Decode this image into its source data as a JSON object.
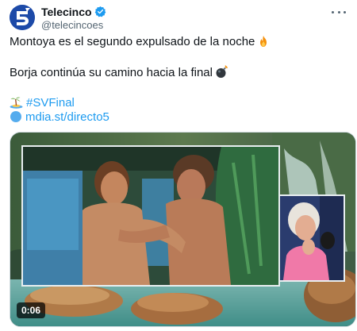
{
  "tweet": {
    "display_name": "Telecinco",
    "handle": "@telecincoes",
    "avatar_icon": "telecinco-5-logo",
    "verified_icon": "verified-badge-icon",
    "more_icon": "more-options-icon",
    "line1": "Montoya es el segundo expulsado de la noche",
    "line1_emoji": "fire-icon",
    "line2": "Borja continúa su camino hacia la final",
    "line2_emoji": "bomb-icon",
    "hashtag": "#SVFinal",
    "hashtag_icon": "desert-island-icon",
    "link": "mdia.st/directo5",
    "link_icon": "blue-circle-icon"
  },
  "media": {
    "type": "video",
    "duration": "0:06"
  },
  "colors": {
    "link": "#1d9bf0",
    "text": "#0f1419",
    "secondary": "#536471",
    "avatar": "#1d4aa8"
  }
}
